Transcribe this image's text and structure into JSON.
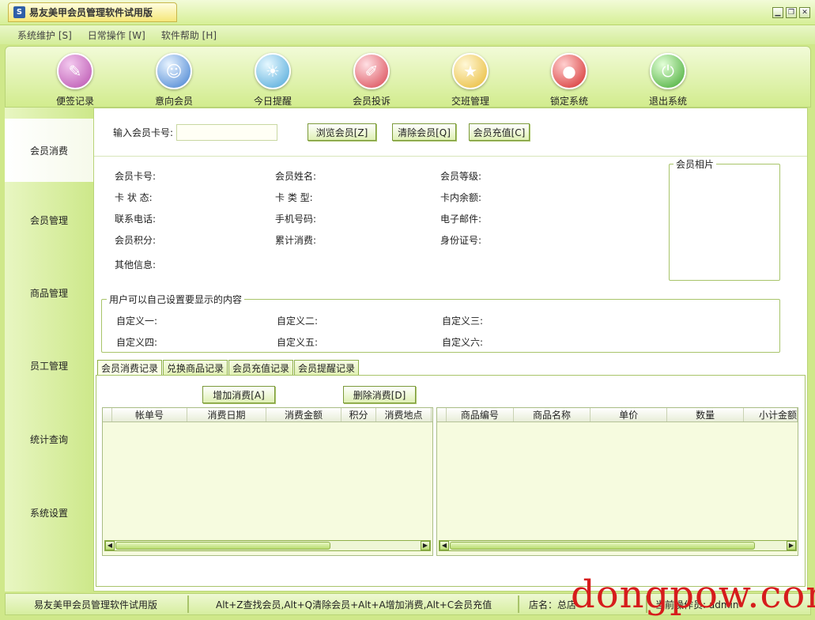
{
  "window": {
    "title": "易友美甲会员管理软件试用版",
    "app_icon": "app-logo-icon",
    "controls": [
      "minimize",
      "restore",
      "close"
    ]
  },
  "menu": [
    "系统维护 [S]",
    "日常操作 [W]",
    "软件帮助 [H]"
  ],
  "toolbar": [
    {
      "label": "便签记录",
      "icon": "notepad-icon",
      "color": "#b84fae"
    },
    {
      "label": "意向会员",
      "icon": "member-card-icon",
      "color": "#3f7ed0"
    },
    {
      "label": "今日提醒",
      "icon": "reminder-icon",
      "color": "#4aa5d8"
    },
    {
      "label": "会员投诉",
      "icon": "complaint-icon",
      "color": "#d8424e"
    },
    {
      "label": "交班管理",
      "icon": "star-icon",
      "color": "#e8b830"
    },
    {
      "label": "锁定系统",
      "icon": "lock-icon",
      "color": "#d42a2a"
    },
    {
      "label": "退出系统",
      "icon": "exit-icon",
      "color": "#3fa82e"
    }
  ],
  "sidebar": [
    "会员消费",
    "会员管理",
    "商品管理",
    "员工管理",
    "统计查询",
    "系统设置"
  ],
  "search": {
    "label": "输入会员卡号:",
    "value": "",
    "browse": "浏览会员[Z]",
    "clear": "清除会员[Q]",
    "recharge": "会员充值[C]"
  },
  "info": {
    "card_no": "会员卡号:",
    "name": "会员姓名:",
    "level": "会员等级:",
    "status": "卡 状 态:",
    "type": "卡 类 型:",
    "balance": "卡内余额:",
    "phone": "联系电话:",
    "mobile": "手机号码:",
    "email": "电子邮件:",
    "points": "会员积分:",
    "total": "累计消费:",
    "id_no": "身份证号:",
    "other": "其他信息:",
    "photo": "会员相片"
  },
  "custom": {
    "title": "用户可以自己设置要显示的内容",
    "c1": "自定义一:",
    "c2": "自定义二:",
    "c3": "自定义三:",
    "c4": "自定义四:",
    "c5": "自定义五:",
    "c6": "自定义六:"
  },
  "tabs": [
    "会员消费记录",
    "兑换商品记录",
    "会员充值记录",
    "会员提醒记录"
  ],
  "actions": {
    "add": "增加消费[A]",
    "del": "删除消费[D]"
  },
  "grid_left_cols": [
    "帐单号",
    "消费日期",
    "消费金额",
    "积分",
    "消费地点"
  ],
  "grid_right_cols": [
    "商品编号",
    "商品名称",
    "单价",
    "数量",
    "小计金额"
  ],
  "status": {
    "app": "易友美甲会员管理软件试用版",
    "shortcuts": "Alt+Z查找会员,Alt+Q清除会员+Alt+A增加消费,Alt+C会员充值",
    "store": "店名：总店",
    "operator": "当前操作员: admin"
  },
  "watermark": "dongpow.com"
}
